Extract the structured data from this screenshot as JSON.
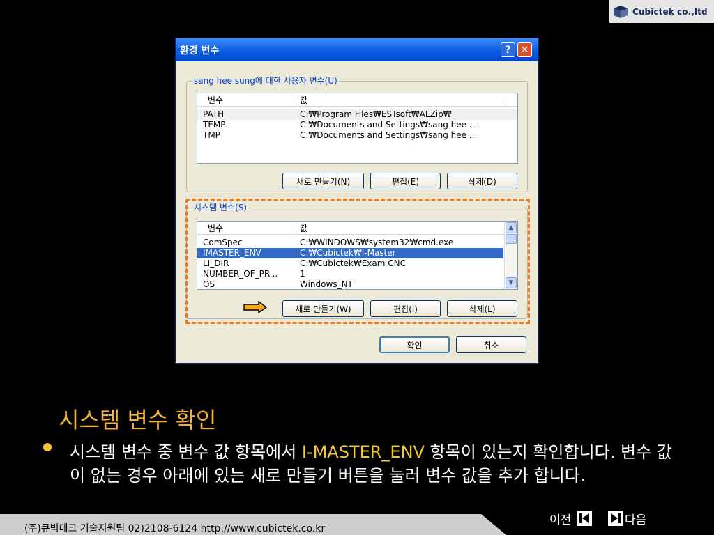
{
  "logo": {
    "text": "Cubictek co.,ltd"
  },
  "dialog": {
    "title": "환경 변수",
    "help_glyph": "?",
    "close_glyph": "✕",
    "user_group": {
      "label": "sang hee sung에 대한 사용자 변수(U)",
      "columns": [
        "변수",
        "값"
      ],
      "rows": [
        {
          "name": "PATH",
          "value": "C:₩Program Files₩ESTsoft₩ALZip₩"
        },
        {
          "name": "TEMP",
          "value": "C:₩Documents and Settings₩sang hee ..."
        },
        {
          "name": "TMP",
          "value": "C:₩Documents and Settings₩sang hee ..."
        }
      ],
      "buttons": {
        "new": "새로 만들기(N)",
        "edit": "편집(E)",
        "delete": "삭제(D)"
      }
    },
    "system_group": {
      "label": "시스템 변수(S)",
      "columns": [
        "변수",
        "값"
      ],
      "rows": [
        {
          "name": "ComSpec",
          "value": "C:₩WINDOWS₩system32₩cmd.exe"
        },
        {
          "name": "IMASTER_ENV",
          "value": "C:₩Cubictek₩I-Master"
        },
        {
          "name": "LI_DIR",
          "value": "C:₩Cubictek₩Exam CNC"
        },
        {
          "name": "NUMBER_OF_PR...",
          "value": "1"
        },
        {
          "name": "OS",
          "value": "Windows_NT"
        }
      ],
      "selected_index": 1,
      "buttons": {
        "new": "새로 만들기(W)",
        "edit": "편집(I)",
        "delete": "삭제(L)"
      }
    },
    "ok": "확인",
    "cancel": "취소"
  },
  "slide": {
    "heading": "시스템 변수 확인",
    "para_1": "시스템 변수 중 변수 값 항목에서 ",
    "para_highlight": "I-MASTER_ENV",
    "para_2": " 항목이 있는지 확인합니다. 변수 값이 없는 경우 아래에 있는 새로 만들기 버튼을 눌러 변수 값을 추가 합니다."
  },
  "footer": {
    "text": "(주)큐빅테크  기술지원팀 02)2108-6124     http://www.cubictek.co.kr"
  },
  "nav": {
    "prev": "이전",
    "next": "다음"
  },
  "colors": {
    "highlight": "#f6c630",
    "heading": "#f2b13c",
    "dash": "#f07a1a",
    "selection": "#316ac5"
  }
}
